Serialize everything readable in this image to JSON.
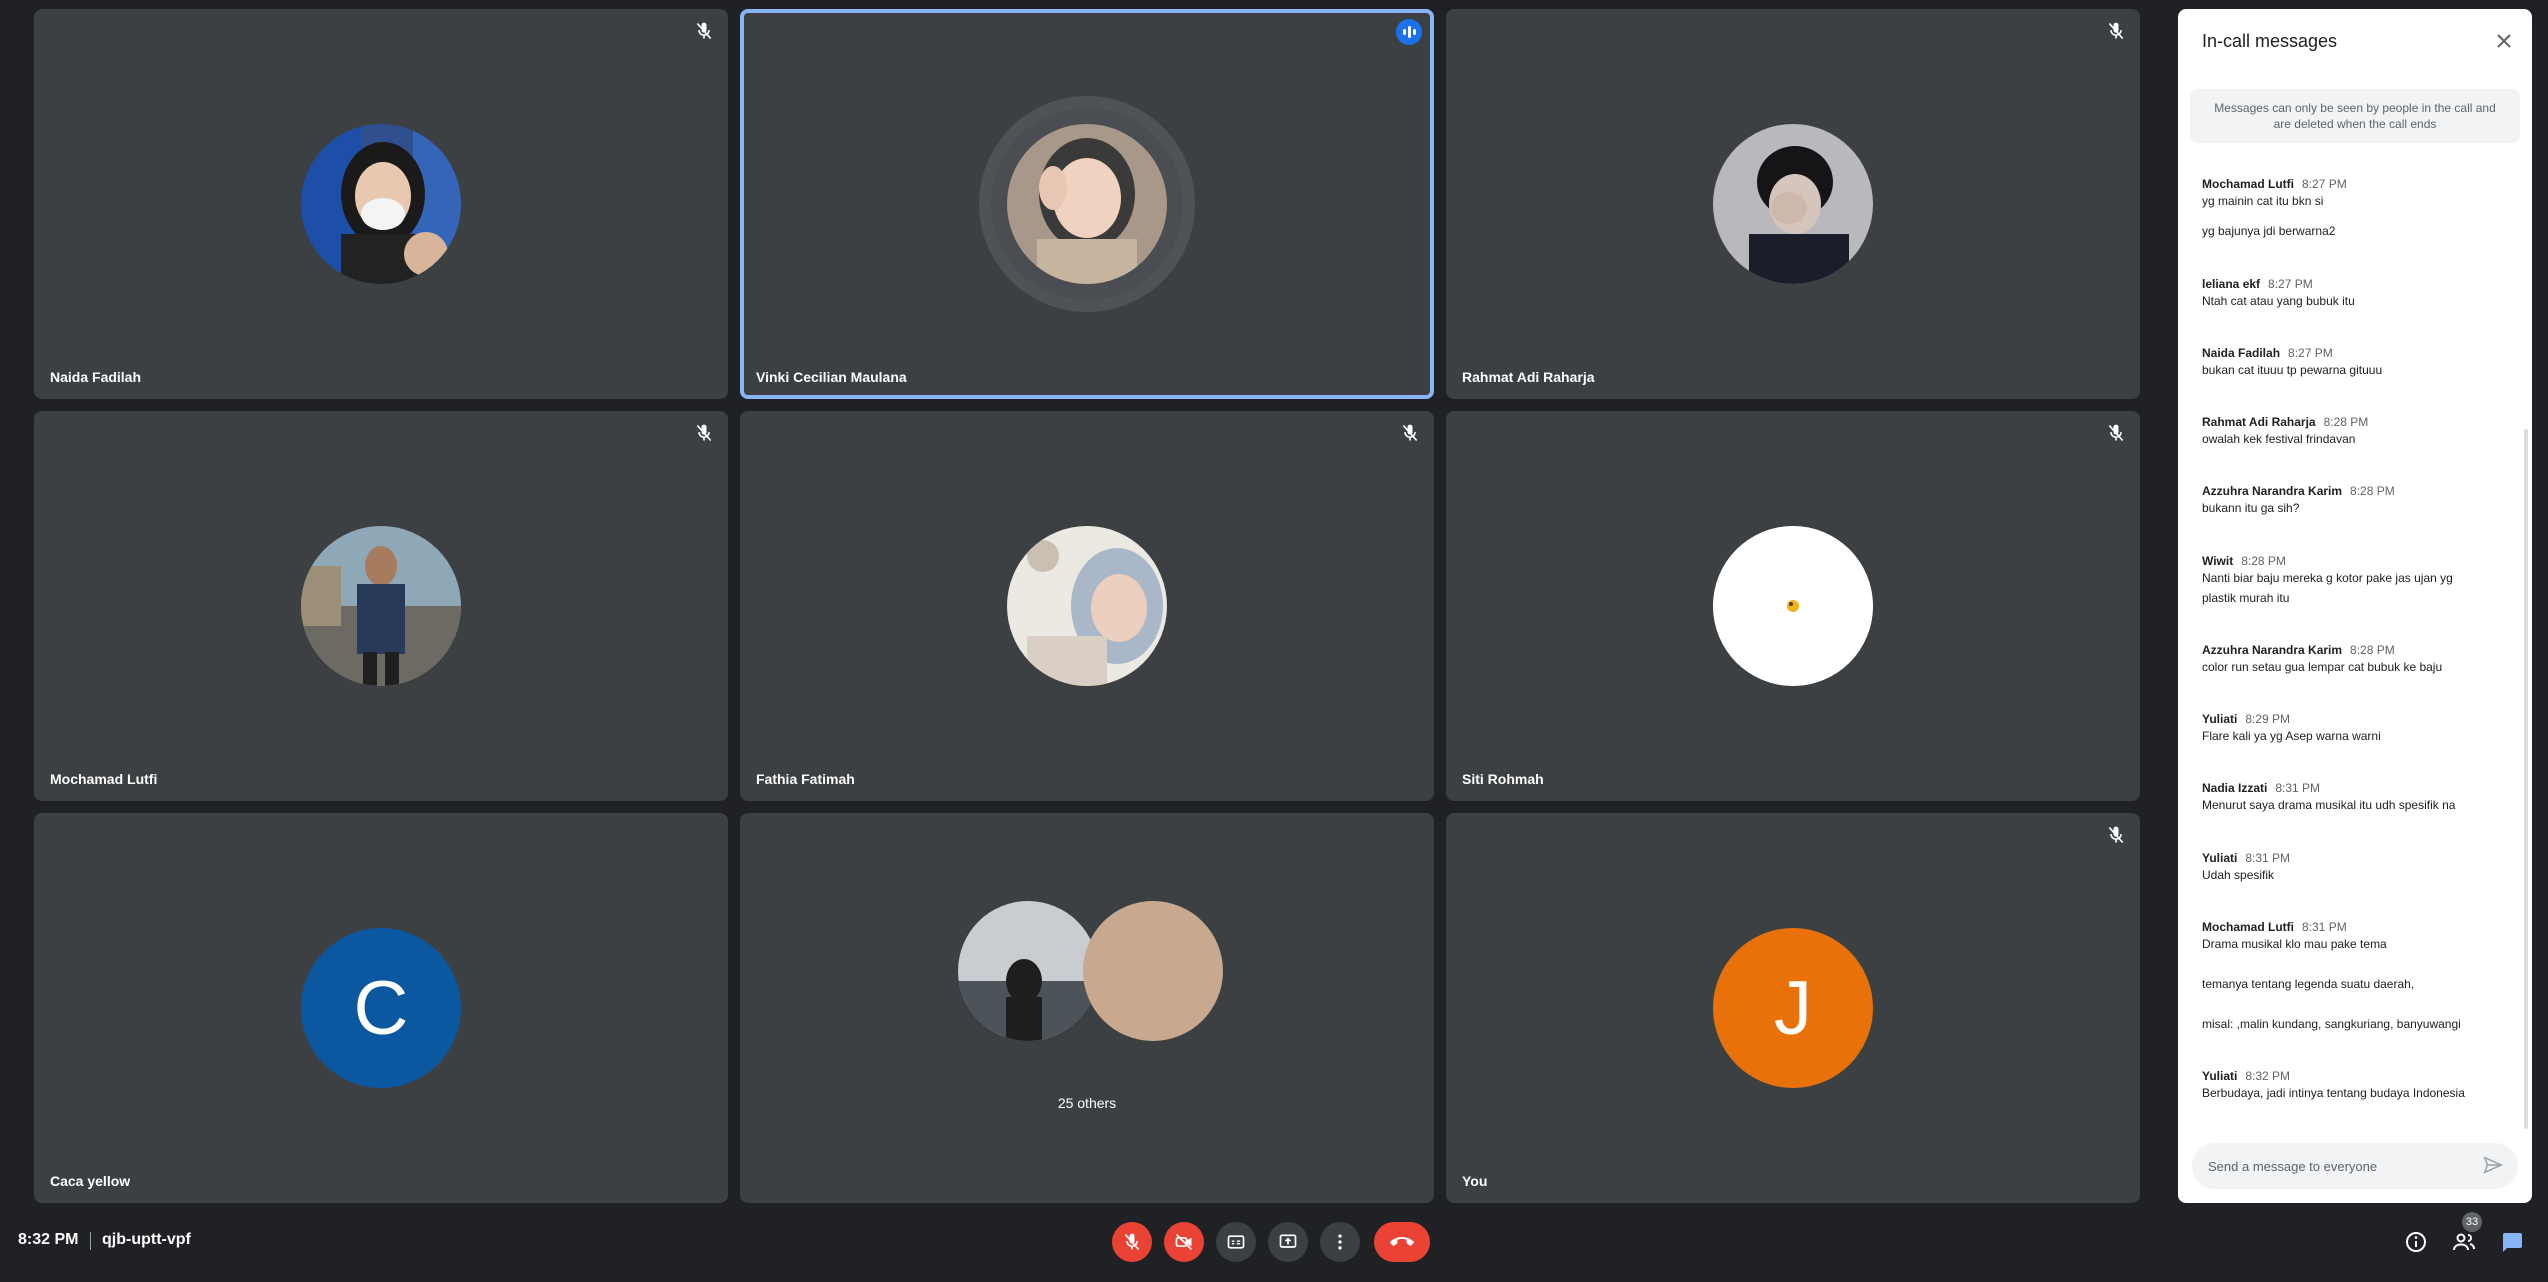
{
  "tiles": [
    {
      "name": "Naida Fadilah",
      "muted": true,
      "avatar": "photo"
    },
    {
      "name": "Vinki Cecilian Maulana",
      "speaking": true,
      "avatar": "photo"
    },
    {
      "name": "Rahmat Adi Raharja",
      "muted": true,
      "avatar": "photo"
    },
    {
      "name": "Mochamad Lutfi",
      "muted": true,
      "avatar": "photo"
    },
    {
      "name": "Fathia Fatimah",
      "muted": true,
      "avatar": "photo"
    },
    {
      "name": "Siti Rohmah",
      "muted": true,
      "avatar": "photo"
    },
    {
      "name": "Caca yellow",
      "letter": "C",
      "color": "#0b57a0"
    },
    {
      "others_label": "25 others"
    },
    {
      "name": "You",
      "muted": true,
      "letter": "J",
      "color": "#e8710a"
    }
  ],
  "panel": {
    "title": "In-call messages",
    "notice": "Messages can only be seen by people in the call and are deleted when the call ends",
    "messages": [
      {
        "sender": "Mochamad Lutfi",
        "time": "8:27 PM",
        "lines": [
          "yg mainin cat itu bkn si",
          "yg bajunya jdi berwarna2"
        ]
      },
      {
        "sender": "leliana ekf",
        "time": "8:27 PM",
        "lines": [
          "Ntah cat atau yang bubuk itu"
        ]
      },
      {
        "sender": "Naida Fadilah",
        "time": "8:27 PM",
        "lines": [
          "bukan cat ituuu tp pewarna gituuu"
        ]
      },
      {
        "sender": "Rahmat Adi Raharja",
        "time": "8:28 PM",
        "lines": [
          "owalah kek festival frindavan"
        ]
      },
      {
        "sender": "Azzuhra Narandra Karim",
        "time": "8:28 PM",
        "lines": [
          "bukann itu ga sih?"
        ]
      },
      {
        "sender": "Wiwit",
        "time": "8:28 PM",
        "lines": [
          "Nanti biar baju mereka g kotor pake jas ujan yg",
          "plastik murah itu"
        ]
      },
      {
        "sender": "Azzuhra Narandra Karim",
        "time": "8:28 PM",
        "lines": [
          "color run setau gua lempar cat bubuk ke baju"
        ]
      },
      {
        "sender": "Yuliati",
        "time": "8:29 PM",
        "lines": [
          "Flare kali ya yg Asep warna warni"
        ]
      },
      {
        "sender": "Nadia Izzati",
        "time": "8:31 PM",
        "lines": [
          "Menurut saya drama musikal itu udh spesifik na"
        ]
      },
      {
        "sender": "Yuliati",
        "time": "8:31 PM",
        "lines": [
          "Udah spesifik"
        ]
      },
      {
        "sender": "Mochamad Lutfi",
        "time": "8:31 PM",
        "lines": [
          "Drama musikal klo mau pake tema",
          "temanya tentang legenda suatu daerah,",
          "misal: ,malin kundang, sangkuriang, banyuwangi"
        ]
      },
      {
        "sender": "Yuliati",
        "time": "8:32 PM",
        "lines": [
          "Berbudaya, jadi intinya tentang budaya Indonesia"
        ]
      }
    ],
    "compose_placeholder": "Send a message to everyone"
  },
  "bottom": {
    "time": "8:32 PM",
    "meeting_code": "qjb-uptt-vpf",
    "participant_count": "33"
  },
  "colors": {
    "accent": "#8ab4f8",
    "danger": "#ea4335",
    "tile": "#3c4043",
    "background": "#202124"
  }
}
